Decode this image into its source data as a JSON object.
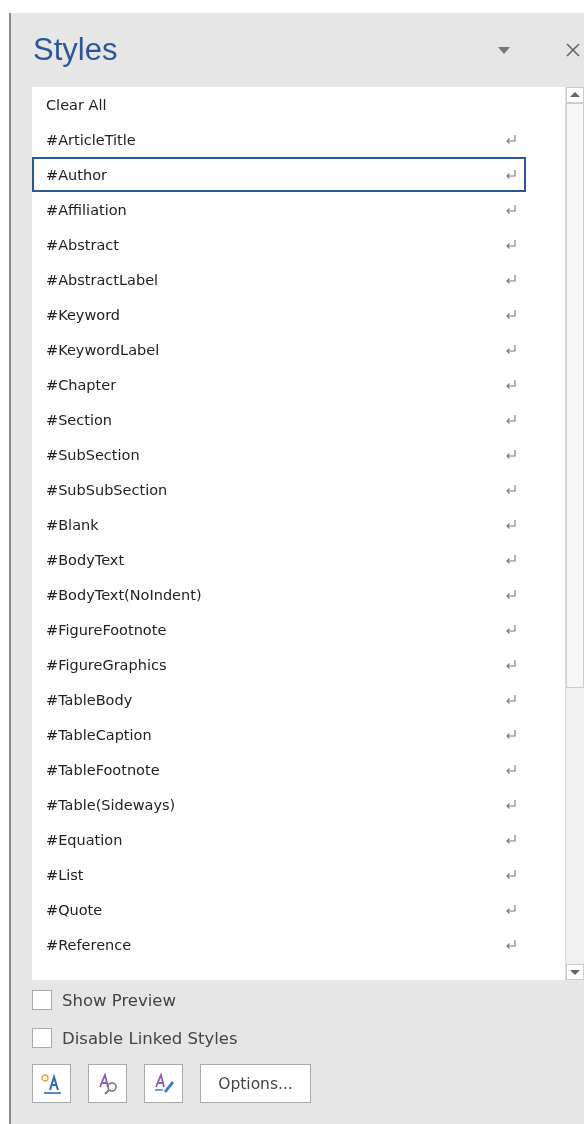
{
  "pane": {
    "title": "Styles"
  },
  "styles": [
    {
      "label": "Clear All",
      "kind": "command",
      "selected": false
    },
    {
      "label": "#ArticleTitle",
      "kind": "paragraph",
      "selected": false
    },
    {
      "label": "#Author",
      "kind": "paragraph",
      "selected": true
    },
    {
      "label": "#Affiliation",
      "kind": "paragraph",
      "selected": false
    },
    {
      "label": "#Abstract",
      "kind": "paragraph",
      "selected": false
    },
    {
      "label": "#AbstractLabel",
      "kind": "paragraph",
      "selected": false
    },
    {
      "label": "#Keyword",
      "kind": "paragraph",
      "selected": false
    },
    {
      "label": "#KeywordLabel",
      "kind": "paragraph",
      "selected": false
    },
    {
      "label": "#Chapter",
      "kind": "paragraph",
      "selected": false
    },
    {
      "label": "#Section",
      "kind": "paragraph",
      "selected": false
    },
    {
      "label": "#SubSection",
      "kind": "paragraph",
      "selected": false
    },
    {
      "label": "#SubSubSection",
      "kind": "paragraph",
      "selected": false
    },
    {
      "label": "#Blank",
      "kind": "paragraph",
      "selected": false
    },
    {
      "label": "#BodyText",
      "kind": "paragraph",
      "selected": false
    },
    {
      "label": "#BodyText(NoIndent)",
      "kind": "paragraph",
      "selected": false
    },
    {
      "label": "#FigureFootnote",
      "kind": "paragraph",
      "selected": false
    },
    {
      "label": "#FigureGraphics",
      "kind": "paragraph",
      "selected": false
    },
    {
      "label": "#TableBody",
      "kind": "paragraph",
      "selected": false
    },
    {
      "label": "#TableCaption",
      "kind": "paragraph",
      "selected": false
    },
    {
      "label": "#TableFootnote",
      "kind": "paragraph",
      "selected": false
    },
    {
      "label": "#Table(Sideways)",
      "kind": "paragraph",
      "selected": false
    },
    {
      "label": "#Equation",
      "kind": "paragraph",
      "selected": false
    },
    {
      "label": "#List",
      "kind": "paragraph",
      "selected": false
    },
    {
      "label": "#Quote",
      "kind": "paragraph",
      "selected": false
    },
    {
      "label": "#Reference",
      "kind": "paragraph",
      "selected": false
    }
  ],
  "options": [
    {
      "label": "Show Preview",
      "checked": false
    },
    {
      "label": "Disable Linked Styles",
      "checked": false
    }
  ],
  "buttons": {
    "options": "Options..."
  }
}
